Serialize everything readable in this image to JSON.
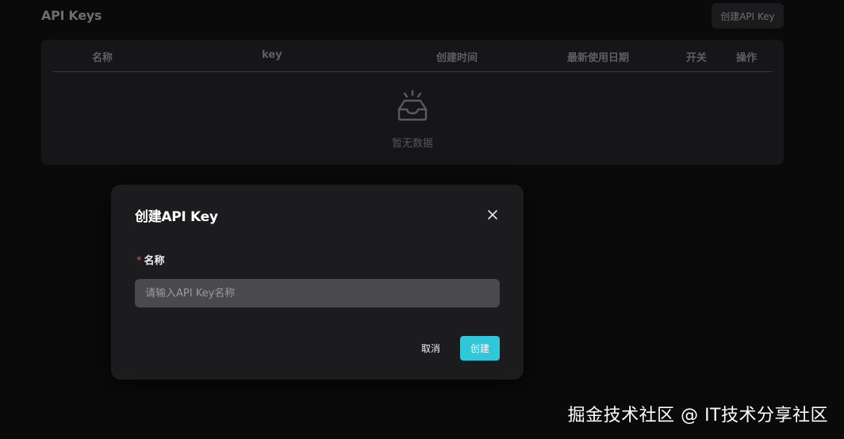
{
  "header": {
    "title": "API Keys",
    "create_button_label": "创建API Key"
  },
  "table": {
    "columns": [
      "名称",
      "key",
      "创建时间",
      "最新使用日期",
      "开关",
      "操作"
    ],
    "empty_text": "暂无数据",
    "empty_icon": "inbox-icon"
  },
  "modal": {
    "title": "创建API Key",
    "close_icon": "close-icon",
    "field": {
      "required_mark": "*",
      "label": "名称",
      "value": "",
      "placeholder": "请输入API Key名称"
    },
    "cancel_label": "取消",
    "submit_label": "创建"
  },
  "watermark": "掘金技术社区 @ IT技术分享社区",
  "colors": {
    "background": "#0a0a0b",
    "modal": "#1c1c1e",
    "accent": "#2fc7d9",
    "required": "#e5484d"
  }
}
